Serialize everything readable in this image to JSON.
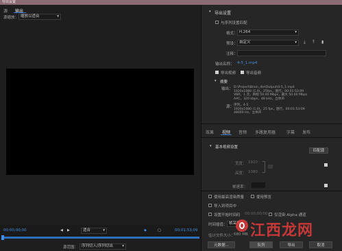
{
  "window": {
    "title": "导出设置"
  },
  "left": {
    "tabs": [
      {
        "label": "源"
      },
      {
        "label": "输出"
      }
    ],
    "source_scaling_label": "源缩放：",
    "source_scaling_value": "缩放以适合",
    "timecode_start": "00;00;00;00",
    "timecode_end": "00;01;53;09",
    "fit_value": "适合",
    "source_range_label": "源范围：",
    "source_range_value": "序列切入/序列切出"
  },
  "export": {
    "section_title": "导出设置",
    "match_sequence_label": "与序列设置匹配",
    "format_label": "格式：",
    "format_value": "H.264",
    "preset_label": "预设：",
    "preset_value": "自定义",
    "comments_label": "注释：",
    "output_name_label": "输出名称：",
    "output_name_value": "4-5_1.mp4",
    "export_video_label": "导出视频",
    "export_audio_label": "导出音频",
    "summary_title": "摘要",
    "output_label": "输出：",
    "output_lines": [
      "D:\\Project\\Brain_die\\Output\\4-5_1.mp4",
      "1920x1080 (1.0)，25fps，逐行，00:01:53:09",
      "VBR，1 次，目标 50.00 Mbps，最大 50.00 Mbps",
      "AAC，320 kbps，48 kHz，立体声"
    ],
    "source_label": "源：",
    "source_lines": [
      "序列，4-5",
      "1920x1080 (1.0)，25 fps，逐行，00:01:53:09",
      "48000 Hz，立体声"
    ]
  },
  "tabs2": [
    {
      "label": "效果"
    },
    {
      "label": "视频"
    },
    {
      "label": "音频"
    },
    {
      "label": "多路复用器"
    },
    {
      "label": "字幕"
    },
    {
      "label": "发布"
    }
  ],
  "video": {
    "section_title": "基本视频设置",
    "match_source_label": "匹配源",
    "width_label": "宽度：",
    "width_value": "1920",
    "height_label": "高度：",
    "height_value": "1080",
    "framerate_label": "帧速率："
  },
  "options": {
    "max_render_quality": "使用最高渲染质量",
    "use_previews": "使用预览",
    "import_into_project": "导入到项目中",
    "set_start_timecode": "设置开始时间码",
    "start_timecode_value": "00;00;00;00",
    "render_alpha_only": "仅渲染 Alpha 通道",
    "interpolation_label": "时间插值：",
    "interpolation_value": "帧采样",
    "file_size_label": "估计文件大小：",
    "file_size_value": "680 MB"
  },
  "buttons": {
    "metadata": "元数据...",
    "queue": "队列",
    "export": "导出",
    "cancel": "取消"
  },
  "watermark": {
    "text": "江西龙网"
  }
}
